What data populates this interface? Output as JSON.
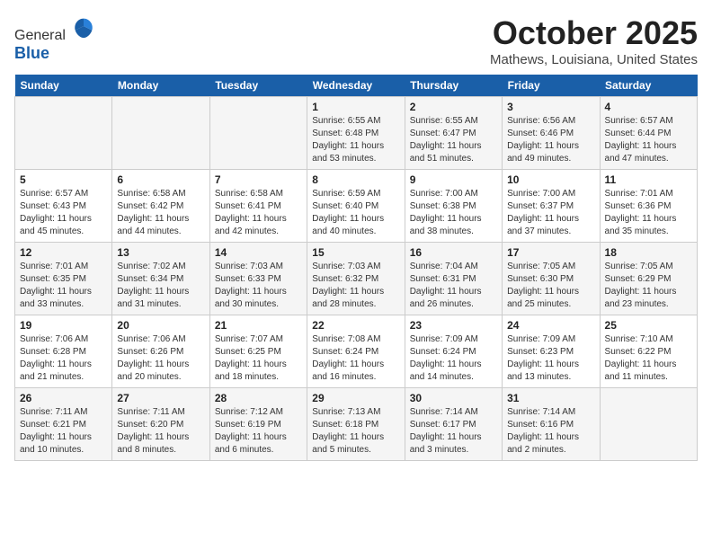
{
  "header": {
    "logo_general": "General",
    "logo_blue": "Blue",
    "month_title": "October 2025",
    "location": "Mathews, Louisiana, United States"
  },
  "days_of_week": [
    "Sunday",
    "Monday",
    "Tuesday",
    "Wednesday",
    "Thursday",
    "Friday",
    "Saturday"
  ],
  "weeks": [
    [
      {
        "day": "",
        "info": ""
      },
      {
        "day": "",
        "info": ""
      },
      {
        "day": "",
        "info": ""
      },
      {
        "day": "1",
        "info": "Sunrise: 6:55 AM\nSunset: 6:48 PM\nDaylight: 11 hours\nand 53 minutes."
      },
      {
        "day": "2",
        "info": "Sunrise: 6:55 AM\nSunset: 6:47 PM\nDaylight: 11 hours\nand 51 minutes."
      },
      {
        "day": "3",
        "info": "Sunrise: 6:56 AM\nSunset: 6:46 PM\nDaylight: 11 hours\nand 49 minutes."
      },
      {
        "day": "4",
        "info": "Sunrise: 6:57 AM\nSunset: 6:44 PM\nDaylight: 11 hours\nand 47 minutes."
      }
    ],
    [
      {
        "day": "5",
        "info": "Sunrise: 6:57 AM\nSunset: 6:43 PM\nDaylight: 11 hours\nand 45 minutes."
      },
      {
        "day": "6",
        "info": "Sunrise: 6:58 AM\nSunset: 6:42 PM\nDaylight: 11 hours\nand 44 minutes."
      },
      {
        "day": "7",
        "info": "Sunrise: 6:58 AM\nSunset: 6:41 PM\nDaylight: 11 hours\nand 42 minutes."
      },
      {
        "day": "8",
        "info": "Sunrise: 6:59 AM\nSunset: 6:40 PM\nDaylight: 11 hours\nand 40 minutes."
      },
      {
        "day": "9",
        "info": "Sunrise: 7:00 AM\nSunset: 6:38 PM\nDaylight: 11 hours\nand 38 minutes."
      },
      {
        "day": "10",
        "info": "Sunrise: 7:00 AM\nSunset: 6:37 PM\nDaylight: 11 hours\nand 37 minutes."
      },
      {
        "day": "11",
        "info": "Sunrise: 7:01 AM\nSunset: 6:36 PM\nDaylight: 11 hours\nand 35 minutes."
      }
    ],
    [
      {
        "day": "12",
        "info": "Sunrise: 7:01 AM\nSunset: 6:35 PM\nDaylight: 11 hours\nand 33 minutes."
      },
      {
        "day": "13",
        "info": "Sunrise: 7:02 AM\nSunset: 6:34 PM\nDaylight: 11 hours\nand 31 minutes."
      },
      {
        "day": "14",
        "info": "Sunrise: 7:03 AM\nSunset: 6:33 PM\nDaylight: 11 hours\nand 30 minutes."
      },
      {
        "day": "15",
        "info": "Sunrise: 7:03 AM\nSunset: 6:32 PM\nDaylight: 11 hours\nand 28 minutes."
      },
      {
        "day": "16",
        "info": "Sunrise: 7:04 AM\nSunset: 6:31 PM\nDaylight: 11 hours\nand 26 minutes."
      },
      {
        "day": "17",
        "info": "Sunrise: 7:05 AM\nSunset: 6:30 PM\nDaylight: 11 hours\nand 25 minutes."
      },
      {
        "day": "18",
        "info": "Sunrise: 7:05 AM\nSunset: 6:29 PM\nDaylight: 11 hours\nand 23 minutes."
      }
    ],
    [
      {
        "day": "19",
        "info": "Sunrise: 7:06 AM\nSunset: 6:28 PM\nDaylight: 11 hours\nand 21 minutes."
      },
      {
        "day": "20",
        "info": "Sunrise: 7:06 AM\nSunset: 6:26 PM\nDaylight: 11 hours\nand 20 minutes."
      },
      {
        "day": "21",
        "info": "Sunrise: 7:07 AM\nSunset: 6:25 PM\nDaylight: 11 hours\nand 18 minutes."
      },
      {
        "day": "22",
        "info": "Sunrise: 7:08 AM\nSunset: 6:24 PM\nDaylight: 11 hours\nand 16 minutes."
      },
      {
        "day": "23",
        "info": "Sunrise: 7:09 AM\nSunset: 6:24 PM\nDaylight: 11 hours\nand 14 minutes."
      },
      {
        "day": "24",
        "info": "Sunrise: 7:09 AM\nSunset: 6:23 PM\nDaylight: 11 hours\nand 13 minutes."
      },
      {
        "day": "25",
        "info": "Sunrise: 7:10 AM\nSunset: 6:22 PM\nDaylight: 11 hours\nand 11 minutes."
      }
    ],
    [
      {
        "day": "26",
        "info": "Sunrise: 7:11 AM\nSunset: 6:21 PM\nDaylight: 11 hours\nand 10 minutes."
      },
      {
        "day": "27",
        "info": "Sunrise: 7:11 AM\nSunset: 6:20 PM\nDaylight: 11 hours\nand 8 minutes."
      },
      {
        "day": "28",
        "info": "Sunrise: 7:12 AM\nSunset: 6:19 PM\nDaylight: 11 hours\nand 6 minutes."
      },
      {
        "day": "29",
        "info": "Sunrise: 7:13 AM\nSunset: 6:18 PM\nDaylight: 11 hours\nand 5 minutes."
      },
      {
        "day": "30",
        "info": "Sunrise: 7:14 AM\nSunset: 6:17 PM\nDaylight: 11 hours\nand 3 minutes."
      },
      {
        "day": "31",
        "info": "Sunrise: 7:14 AM\nSunset: 6:16 PM\nDaylight: 11 hours\nand 2 minutes."
      },
      {
        "day": "",
        "info": ""
      }
    ]
  ]
}
